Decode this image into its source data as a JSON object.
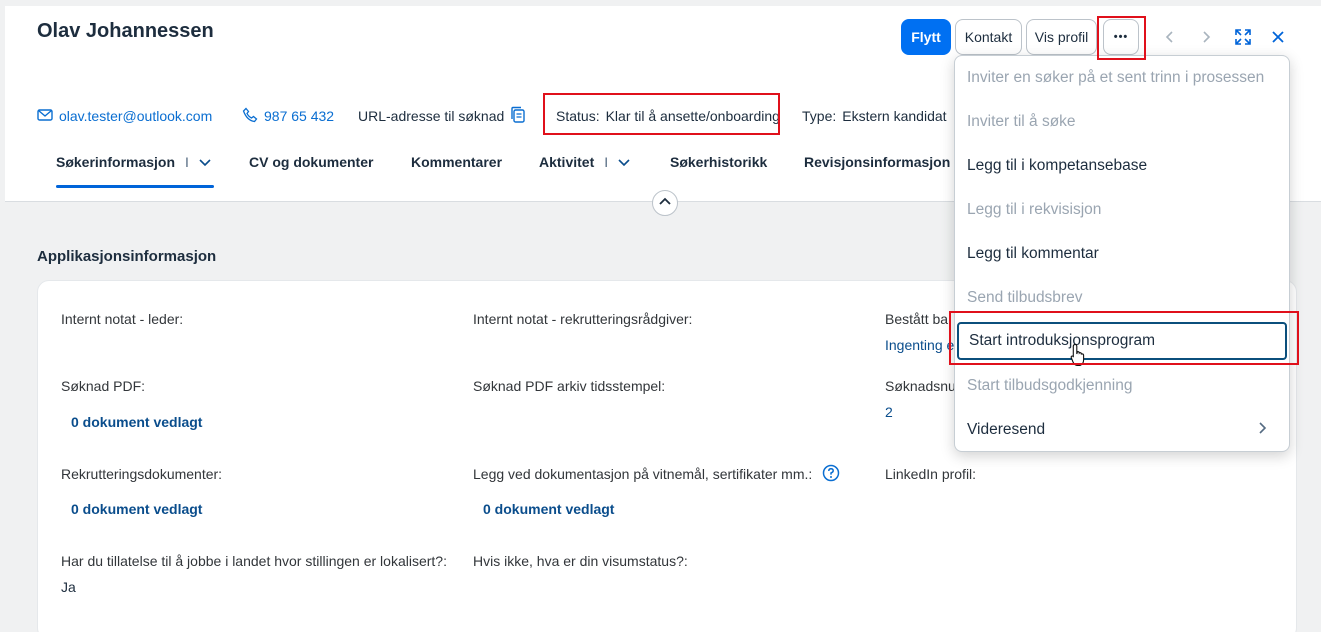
{
  "candidate": {
    "name": "Olav Johannessen"
  },
  "toolbar": {
    "move_label": "Flytt",
    "contact_label": "Kontakt",
    "profile_label": "Vis profil",
    "more_label": "•••"
  },
  "info": {
    "email": "olav.tester@outlook.com",
    "phone": "987 65 432",
    "url_label": "URL-adresse til søknad",
    "status_label": "Status:",
    "status_value": "Klar til å ansette/onboarding",
    "type_label": "Type:",
    "type_value": "Ekstern kandidat"
  },
  "tabs": [
    {
      "label": "Søkerinformasjon",
      "sep": "I"
    },
    {
      "label": "CV og dokumenter"
    },
    {
      "label": "Kommentarer"
    },
    {
      "label": "Aktivitet",
      "sep": "I"
    },
    {
      "label": "Søkerhistorikk"
    },
    {
      "label": "Revisjonsinformasjon"
    }
  ],
  "section": {
    "title": "Applikasjonsinformasjon"
  },
  "fields": {
    "internal_note_manager": {
      "label": "Internt notat - leder:"
    },
    "internal_note_recruiter": {
      "label": "Internt notat - rekrutteringsrådgiver:"
    },
    "passed": {
      "label": "Bestått ba",
      "value": "Ingenting e"
    },
    "application_pdf": {
      "label": "Søknad PDF:",
      "value": "0 dokument vedlagt"
    },
    "application_pdf_archive": {
      "label": "Søknad PDF arkiv tidsstempel:"
    },
    "application_number": {
      "label": "Søknadsnu",
      "value": "2"
    },
    "recruitment_docs": {
      "label": "Rekrutteringsdokumenter:",
      "value": "0 dokument vedlagt"
    },
    "certificates": {
      "label": "Legg ved dokumentasjon på vitnemål, sertifikater mm.:",
      "value": "0 dokument vedlagt"
    },
    "linkedin": {
      "label": "LinkedIn profil:"
    },
    "work_permit": {
      "label": "Har du tillatelse til å jobbe i landet hvor stillingen er lokalisert?:",
      "value": "Ja"
    },
    "visa_status": {
      "label": "Hvis ikke, hva er din visumstatus?:"
    }
  },
  "menu": {
    "items": [
      {
        "label": "Inviter en søker på et sent trinn i prosessen",
        "state": "disabled"
      },
      {
        "label": "Inviter til å søke",
        "state": "disabled"
      },
      {
        "label": "Legg til i kompetansebase",
        "state": "enabled"
      },
      {
        "label": "Legg til i rekvisisjon",
        "state": "disabled"
      },
      {
        "label": "Legg til kommentar",
        "state": "enabled"
      },
      {
        "label": "Send tilbudsbrev",
        "state": "disabled"
      },
      {
        "label": "Start introduksjonsprogram",
        "state": "focused"
      },
      {
        "label": "Start tilbudsgodkjenning",
        "state": "disabled"
      },
      {
        "label": "Videresend",
        "state": "enabled"
      }
    ]
  },
  "colors": {
    "primary": "#0070f2",
    "link": "#0a6ed1",
    "highlight": "#e0101b"
  }
}
